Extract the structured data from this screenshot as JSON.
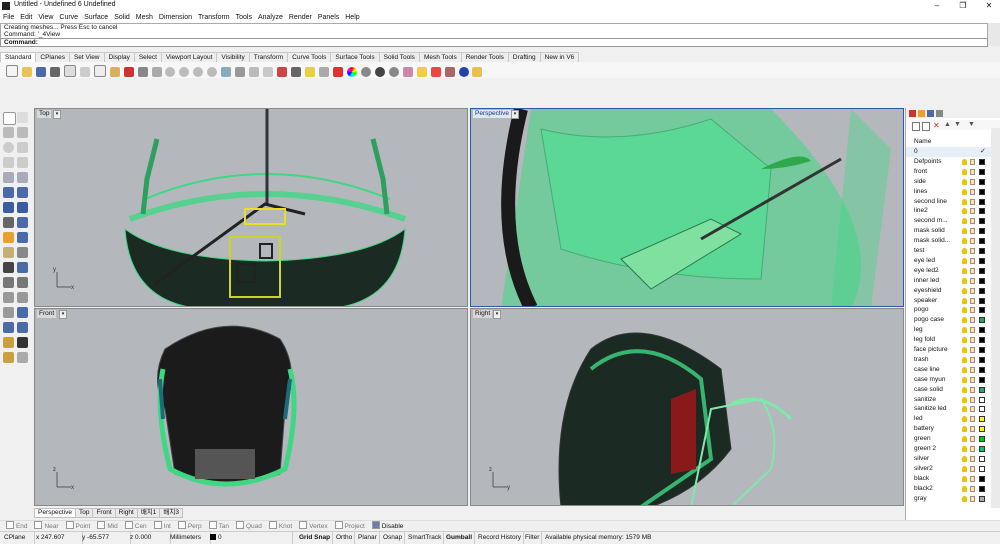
{
  "window": {
    "title": "Untitled - Undefined 6 Undefined"
  },
  "menu": [
    "File",
    "Edit",
    "View",
    "Curve",
    "Surface",
    "Solid",
    "Mesh",
    "Dimension",
    "Transform",
    "Tools",
    "Analyze",
    "Render",
    "Panels",
    "Help"
  ],
  "command": {
    "history_line1": "Creating meshes... Press Esc to cancel",
    "history_line2": "Command: '_4View",
    "prompt": "Command:"
  },
  "tabs": [
    "Standard",
    "CPlanes",
    "Set View",
    "Display",
    "Select",
    "Viewport Layout",
    "Visibility",
    "Transform",
    "Curve Tools",
    "Surface Tools",
    "Solid Tools",
    "Mesh Tools",
    "Render Tools",
    "Drafting",
    "New in V6"
  ],
  "active_tab": "Standard",
  "viewports": {
    "top": "Top",
    "perspective": "Perspective",
    "front": "Front",
    "right": "Right"
  },
  "viewport_tabs": [
    "Perspective",
    "Top",
    "Front",
    "Right",
    "배치1",
    "배치3"
  ],
  "osnap": [
    "End",
    "Near",
    "Point",
    "Mid",
    "Cen",
    "Int",
    "Perp",
    "Tan",
    "Quad",
    "Knot",
    "Vertex",
    "Project",
    "Disable"
  ],
  "status": {
    "cplane": "CPlane",
    "x": "x 247.607",
    "y": "y -65.577",
    "z": "z 0.000",
    "units": "Millimeters",
    "layer": "0",
    "grid_snap": "Grid Snap",
    "ortho": "Ortho",
    "planar": "Planar",
    "osnap": "Osnap",
    "smarttrack": "SmartTrack",
    "gumball": "Gumball",
    "record_history": "Record History",
    "filter": "Filter",
    "memory": "Available physical memory: 1579 MB"
  },
  "layers": {
    "header": "Name",
    "items": [
      {
        "name": "0",
        "color": "#000000",
        "current": true
      },
      {
        "name": "Defpoints",
        "color": "#000000"
      },
      {
        "name": "front",
        "color": "#000000"
      },
      {
        "name": "side",
        "color": "#000000"
      },
      {
        "name": "lines",
        "color": "#000000"
      },
      {
        "name": "second line",
        "color": "#000000"
      },
      {
        "name": "line2",
        "color": "#000000"
      },
      {
        "name": "second m...",
        "color": "#000000"
      },
      {
        "name": "mask solid",
        "color": "#000000"
      },
      {
        "name": "mask solid...",
        "color": "#000000"
      },
      {
        "name": "test",
        "color": "#000000"
      },
      {
        "name": "eye led",
        "color": "#000000"
      },
      {
        "name": "eye led2",
        "color": "#000000"
      },
      {
        "name": "inner led",
        "color": "#000000"
      },
      {
        "name": "eyeshield",
        "color": "#000000"
      },
      {
        "name": "speaker",
        "color": "#000000"
      },
      {
        "name": "pogo",
        "color": "#000000"
      },
      {
        "name": "pogo case",
        "color": "#22aa44"
      },
      {
        "name": "leg",
        "color": "#000000"
      },
      {
        "name": "leg fold",
        "color": "#000000"
      },
      {
        "name": "face picture",
        "color": "#000000"
      },
      {
        "name": "trash",
        "color": "#000000"
      },
      {
        "name": "case line",
        "color": "#000000"
      },
      {
        "name": "case myun",
        "color": "#000000"
      },
      {
        "name": "case solid",
        "color": "#2aa86a"
      },
      {
        "name": "sanitize",
        "color": "#ffffff"
      },
      {
        "name": "sanitize led",
        "color": "#ffffff"
      },
      {
        "name": "led",
        "color": "#ffff00"
      },
      {
        "name": "battery",
        "color": "#ffff00"
      },
      {
        "name": "green",
        "color": "#00cc00"
      },
      {
        "name": "green 2",
        "color": "#00cc66"
      },
      {
        "name": "silver",
        "color": "#ffffff"
      },
      {
        "name": "silver2",
        "color": "#ffffff"
      },
      {
        "name": "black",
        "color": "#000000"
      },
      {
        "name": "black2",
        "color": "#000000"
      },
      {
        "name": "gray",
        "color": "#aaaaaa"
      }
    ]
  },
  "colors": {
    "viewport_bg": "#b4b8bc",
    "model_green": "#3fd783",
    "model_dark": "#1a1a1a"
  }
}
